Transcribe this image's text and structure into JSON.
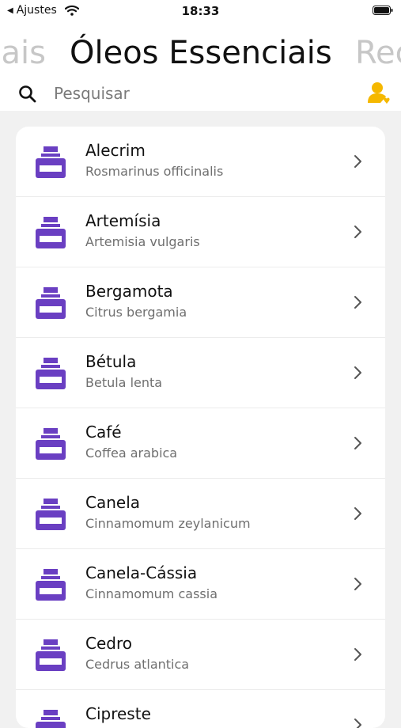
{
  "status_bar": {
    "back_label": "Ajustes",
    "time": "18:33"
  },
  "header": {
    "prev_tab": "ais",
    "current_tab": "Óleos Essenciais",
    "next_tab": "Rec"
  },
  "search": {
    "placeholder": "Pesquisar"
  },
  "colors": {
    "accent": "#6a3fc2",
    "profile": "#f5b800"
  },
  "items": [
    {
      "name": "Alecrim",
      "scientific": "Rosmarinus officinalis"
    },
    {
      "name": "Artemísia",
      "scientific": "Artemisia vulgaris"
    },
    {
      "name": "Bergamota",
      "scientific": "Citrus bergamia"
    },
    {
      "name": "Bétula",
      "scientific": "Betula lenta"
    },
    {
      "name": "Café",
      "scientific": "Coffea arabica"
    },
    {
      "name": "Canela",
      "scientific": "Cinnamomum zeylanicum"
    },
    {
      "name": "Canela-Cássia",
      "scientific": "Cinnamomum cassia"
    },
    {
      "name": "Cedro",
      "scientific": "Cedrus atlantica"
    },
    {
      "name": "Cipreste",
      "scientific": ""
    }
  ]
}
